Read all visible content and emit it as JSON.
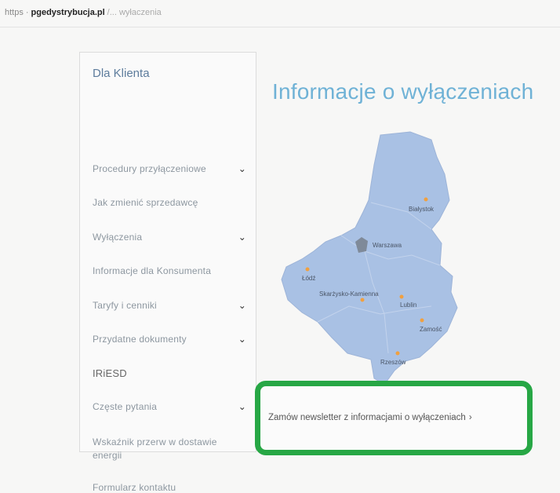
{
  "browser": {
    "protocol": "https",
    "separator": "·",
    "domain": "pgedystrybucja.pl",
    "path": "/... wyłaczenia"
  },
  "sidebar": {
    "title": "Dla Klienta",
    "items": [
      {
        "label": "Procedury przyłączeniowe",
        "has_submenu": true
      },
      {
        "label": "Jak zmienić sprzedawcę",
        "has_submenu": false
      },
      {
        "label": "Wyłączenia",
        "has_submenu": true
      },
      {
        "label": "Informacje dla Konsumenta",
        "has_submenu": false
      },
      {
        "label": "Taryfy i cenniki",
        "has_submenu": true
      },
      {
        "label": "Przydatne dokumenty",
        "has_submenu": true
      },
      {
        "label": "IRiESD",
        "has_submenu": false
      },
      {
        "label": "Częste pytania",
        "has_submenu": true
      },
      {
        "label": "Wskaźnik przerw w dostawie energii",
        "has_submenu": false
      },
      {
        "label": "Formularz kontaktu",
        "has_submenu": false
      }
    ],
    "chevron": "⌄"
  },
  "main": {
    "title": "Informacje o wyłączeniach",
    "map": {
      "cities": [
        "Białystok",
        "Warszawa",
        "Łódź",
        "Skarżysko-Kamienna",
        "Lublin",
        "Zamość",
        "Rzeszów"
      ]
    },
    "newsletter": {
      "label": "Zamów newsletter z informacjami o wyłączeniach",
      "arrow": "›"
    }
  },
  "colors": {
    "title": "#6fb2d6",
    "map_fill": "#a9c1e4",
    "city_dot": "#f0a040",
    "highlight_border": "#27a745"
  }
}
